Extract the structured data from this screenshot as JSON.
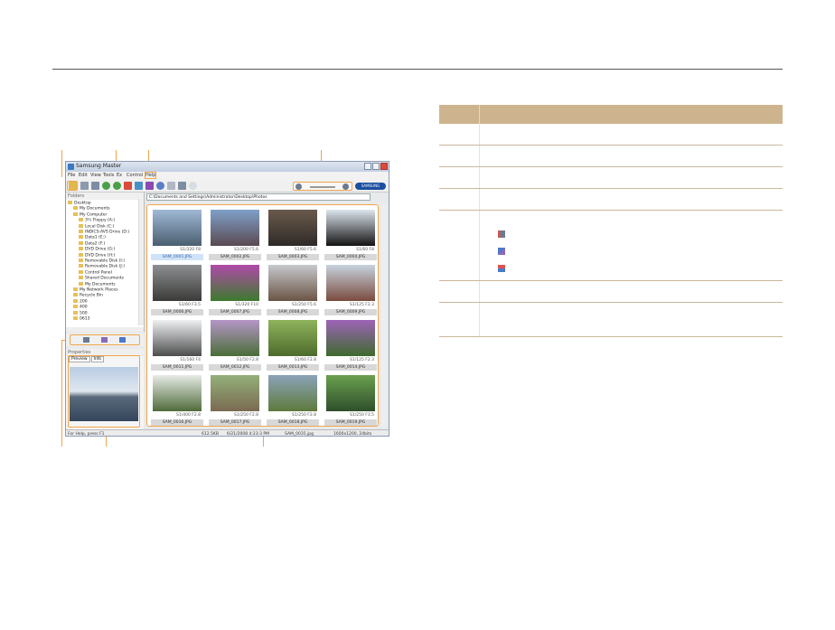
{
  "window": {
    "title": "Samsung Master",
    "menu": [
      "File",
      "Edit",
      "View",
      "Tools",
      "Ex",
      "Control",
      "Help"
    ],
    "logo": "SAMSUNG"
  },
  "folders": {
    "header": "Folders",
    "items": [
      {
        "label": "Desktop",
        "indent": 0
      },
      {
        "label": "My Documents",
        "indent": 1
      },
      {
        "label": "My Computer",
        "indent": 1
      },
      {
        "label": "3½ Floppy (A:)",
        "indent": 2
      },
      {
        "label": "Local Disk (C:)",
        "indent": 2
      },
      {
        "label": "INDICS-AVS Drive (D:)",
        "indent": 2
      },
      {
        "label": "Data1 (E:)",
        "indent": 2
      },
      {
        "label": "Data2 (F:)",
        "indent": 2
      },
      {
        "label": "DVD Drive (G:)",
        "indent": 2
      },
      {
        "label": "DVD Drive (H:)",
        "indent": 2
      },
      {
        "label": "Removable Disk (I:)",
        "indent": 2
      },
      {
        "label": "Removable Disk (J:)",
        "indent": 2
      },
      {
        "label": "Control Panel",
        "indent": 2
      },
      {
        "label": "Shared Documents",
        "indent": 2
      },
      {
        "label": "My Documents",
        "indent": 2
      },
      {
        "label": "My Network Places",
        "indent": 1
      },
      {
        "label": "Recycle Bin",
        "indent": 1
      },
      {
        "label": "200",
        "indent": 1
      },
      {
        "label": "400",
        "indent": 1
      },
      {
        "label": "500",
        "indent": 1
      },
      {
        "label": "0613",
        "indent": 1
      }
    ]
  },
  "preview": {
    "header": "Properties",
    "tabs": [
      "Preview",
      "Info"
    ]
  },
  "address": "C:\\Documents and Settings\\Administrator\\Desktop\\Photos",
  "thumbnails": [
    {
      "name": "SAM_0001.JPG",
      "exif": "S1/320 F8",
      "selected": true,
      "c1": "#9fb9d6",
      "c2": "#4b5e70"
    },
    {
      "name": "SAM_0002.JPG",
      "exif": "S1/200 F5.6",
      "selected": false,
      "c1": "#7fa0c8",
      "c2": "#5a4a52"
    },
    {
      "name": "SAM_0003.JPG",
      "exif": "S1/60 F5.6",
      "selected": false,
      "c1": "#6b5a4c",
      "c2": "#2e2a28"
    },
    {
      "name": "SAM_0004.JPG",
      "exif": "S1/60 F8",
      "selected": false,
      "c1": "#dde6ee",
      "c2": "#141414"
    },
    {
      "name": "SAM_0006.JPG",
      "exif": "S1/60 F3.5",
      "selected": false,
      "c1": "#8d8f92",
      "c2": "#3b3a38"
    },
    {
      "name": "SAM_0007.JPG",
      "exif": "S1/320 F10",
      "selected": false,
      "c1": "#b04aa8",
      "c2": "#3d7a2e"
    },
    {
      "name": "SAM_0008.JPG",
      "exif": "S1/250 F5.6",
      "selected": false,
      "c1": "#c6c8cc",
      "c2": "#6b5444"
    },
    {
      "name": "SAM_0009.JPG",
      "exif": "S1/125 F2.3",
      "selected": false,
      "c1": "#c7d3de",
      "c2": "#7a4b3f"
    },
    {
      "name": "SAM_0011.JPG",
      "exif": "S1/160 F4",
      "selected": false,
      "c1": "#eef0f2",
      "c2": "#4d4d4d"
    },
    {
      "name": "SAM_0012.JPG",
      "exif": "S1/50 F2.8",
      "selected": false,
      "c1": "#b596c7",
      "c2": "#4a6e38"
    },
    {
      "name": "SAM_0013.JPG",
      "exif": "S1/60 F2.8",
      "selected": false,
      "c1": "#8fb35c",
      "c2": "#4d6b2c"
    },
    {
      "name": "SAM_0014.JPG",
      "exif": "S1/125 F2.3",
      "selected": false,
      "c1": "#9d63b8",
      "c2": "#3e6a2e"
    },
    {
      "name": "SAM_0016.JPG",
      "exif": "S1/400 F2.8",
      "selected": false,
      "c1": "#e7ebe6",
      "c2": "#4f6b3b"
    },
    {
      "name": "SAM_0017.JPG",
      "exif": "S1/250 F2.8",
      "selected": false,
      "c1": "#94b07a",
      "c2": "#7a6a52"
    },
    {
      "name": "SAM_0018.JPG",
      "exif": "S1/250 F2.8",
      "selected": false,
      "c1": "#8aa3b8",
      "c2": "#5e7a3c"
    },
    {
      "name": "SAM_0019.JPG",
      "exif": "S1/250 F3.5",
      "selected": false,
      "c1": "#6aa04e",
      "c2": "#2f4f2b"
    }
  ],
  "status": {
    "help": "For Help, press F1",
    "size": "612.5KB",
    "date": "6/21/2008 4:23:3 PM",
    "file": "SAM_0035.jpg",
    "dims": "1600x1200, 24bits"
  },
  "table": {
    "rows": 7
  },
  "colors": {
    "accent": "#f0a54a",
    "table_header": "#ceb48e"
  }
}
